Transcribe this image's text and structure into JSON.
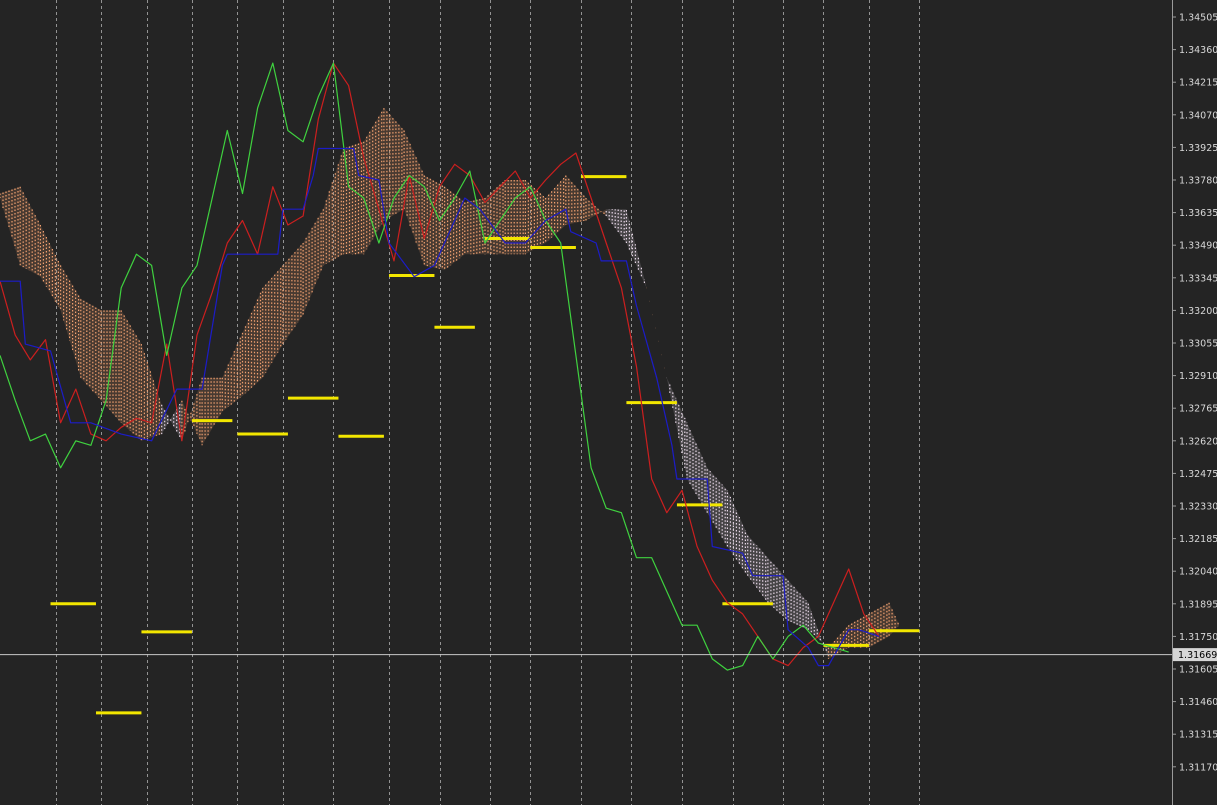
{
  "chart_data": {
    "type": "line",
    "title": "",
    "xlabel": "",
    "ylabel": "",
    "ylim": [
      1.311,
      1.3456
    ],
    "y_ticks": [
      "1.34505",
      "1.34360",
      "1.34215",
      "1.34070",
      "1.33925",
      "1.33780",
      "1.33635",
      "1.33490",
      "1.33345",
      "1.33200",
      "1.33055",
      "1.32910",
      "1.32765",
      "1.32620",
      "1.32475",
      "1.32330",
      "1.32185",
      "1.32040",
      "1.31895",
      "1.31750",
      "1.31605",
      "1.31460",
      "1.31315",
      "1.31170"
    ],
    "current_price": {
      "value": 1.31669,
      "label": "1.31669"
    },
    "grid": "vertical-dashed",
    "n_x": 232,
    "vertical_grid_x": [
      11,
      20,
      29,
      38,
      47,
      56,
      66,
      77,
      87,
      97,
      105,
      115,
      125,
      135,
      145,
      155,
      163,
      172,
      182
    ],
    "levels": [
      {
        "x0": 10,
        "x1": 19,
        "y": 1.31895
      },
      {
        "x0": 19,
        "x1": 28,
        "y": 1.3141
      },
      {
        "x0": 28,
        "x1": 38,
        "y": 1.3177
      },
      {
        "x0": 38,
        "x1": 46,
        "y": 1.3271
      },
      {
        "x0": 47,
        "x1": 57,
        "y": 1.3265
      },
      {
        "x0": 57,
        "x1": 67,
        "y": 1.3281
      },
      {
        "x0": 67,
        "x1": 76,
        "y": 1.3264
      },
      {
        "x0": 77,
        "x1": 86,
        "y": 1.33355
      },
      {
        "x0": 86,
        "x1": 94,
        "y": 1.33125
      },
      {
        "x0": 96,
        "x1": 105,
        "y": 1.3352
      },
      {
        "x0": 105,
        "x1": 114,
        "y": 1.3348
      },
      {
        "x0": 115,
        "x1": 124,
        "y": 1.33795
      },
      {
        "x0": 124,
        "x1": 134,
        "y": 1.3279
      },
      {
        "x0": 134,
        "x1": 143,
        "y": 1.32335
      },
      {
        "x0": 143,
        "x1": 153,
        "y": 1.31895
      },
      {
        "x0": 163,
        "x1": 172,
        "y": 1.3171
      },
      {
        "x0": 172,
        "x1": 182,
        "y": 1.31775
      }
    ],
    "series": [
      {
        "kind": "price",
        "color": "#cc1f1f",
        "x": [
          0,
          3,
          6,
          9,
          12,
          15,
          18,
          21,
          24,
          27,
          30,
          33,
          36,
          39,
          42,
          45,
          48,
          51,
          54,
          57,
          60,
          63,
          66,
          69,
          72,
          75,
          78,
          81,
          84,
          87,
          90,
          93,
          96,
          99,
          102,
          105,
          108,
          111,
          114,
          117,
          120,
          123,
          126,
          129,
          132,
          135,
          138,
          141,
          144,
          147,
          150,
          153,
          156,
          159,
          162,
          165,
          168,
          171,
          174
        ],
        "values": [
          1.3333,
          1.3309,
          1.3298,
          1.3307,
          1.327,
          1.3285,
          1.3265,
          1.3262,
          1.3268,
          1.3272,
          1.327,
          1.3305,
          1.3262,
          1.3309,
          1.3328,
          1.335,
          1.336,
          1.3345,
          1.3375,
          1.3358,
          1.3362,
          1.3405,
          1.343,
          1.342,
          1.3388,
          1.3365,
          1.3342,
          1.338,
          1.3352,
          1.3375,
          1.3385,
          1.338,
          1.3368,
          1.3375,
          1.3382,
          1.337,
          1.3378,
          1.3385,
          1.339,
          1.337,
          1.335,
          1.333,
          1.3295,
          1.3245,
          1.323,
          1.324,
          1.3215,
          1.32,
          1.319,
          1.3185,
          1.3175,
          1.3165,
          1.3162,
          1.317,
          1.3175,
          1.319,
          1.3205,
          1.3185,
          1.3175
        ]
      },
      {
        "kind": "lagging",
        "color": "#3fd23f",
        "x": [
          0,
          3,
          6,
          9,
          12,
          15,
          18,
          21,
          24,
          27,
          30,
          33,
          36,
          39,
          42,
          45,
          48,
          51,
          54,
          57,
          60,
          63,
          66,
          69,
          72,
          75,
          78,
          81,
          84,
          87,
          90,
          93,
          96,
          99,
          102,
          105,
          108,
          111,
          114,
          117,
          120,
          123,
          126,
          129,
          132,
          135,
          138,
          141,
          144,
          147,
          150,
          153,
          156,
          159,
          162,
          165,
          168
        ],
        "values": [
          1.33,
          1.328,
          1.3262,
          1.3265,
          1.325,
          1.3262,
          1.326,
          1.328,
          1.333,
          1.3345,
          1.334,
          1.33,
          1.333,
          1.334,
          1.337,
          1.34,
          1.3372,
          1.341,
          1.343,
          1.34,
          1.3395,
          1.3415,
          1.343,
          1.3375,
          1.337,
          1.335,
          1.337,
          1.338,
          1.3375,
          1.336,
          1.337,
          1.3382,
          1.335,
          1.336,
          1.337,
          1.3375,
          1.336,
          1.335,
          1.33,
          1.325,
          1.3232,
          1.323,
          1.321,
          1.321,
          1.3195,
          1.318,
          1.318,
          1.3165,
          1.316,
          1.3162,
          1.3175,
          1.3165,
          1.3175,
          1.318,
          1.3172,
          1.317,
          1.3168
        ]
      },
      {
        "kind": "kijun",
        "color": "#1c1cc8",
        "x": [
          0,
          4,
          5,
          10,
          14,
          18,
          24,
          30,
          35,
          40,
          44,
          45,
          55,
          56,
          60,
          62,
          63,
          70,
          71,
          75,
          77,
          82,
          86,
          90,
          92,
          95,
          100,
          104,
          108,
          112,
          113,
          118,
          119,
          124,
          126,
          130,
          133,
          134,
          140,
          141,
          147,
          149,
          155,
          156,
          160,
          162,
          164,
          168,
          170,
          174
        ],
        "values": [
          1.3333,
          1.3333,
          1.3305,
          1.3302,
          1.327,
          1.327,
          1.3265,
          1.3262,
          1.3285,
          1.3285,
          1.334,
          1.3345,
          1.3345,
          1.3365,
          1.3365,
          1.338,
          1.3392,
          1.3392,
          1.338,
          1.3378,
          1.335,
          1.3335,
          1.334,
          1.336,
          1.337,
          1.3365,
          1.335,
          1.335,
          1.336,
          1.3365,
          1.3355,
          1.335,
          1.3342,
          1.3342,
          1.3322,
          1.329,
          1.326,
          1.3245,
          1.3245,
          1.3215,
          1.3212,
          1.3202,
          1.3202,
          1.3178,
          1.317,
          1.3162,
          1.3162,
          1.3178,
          1.3178,
          1.3175
        ]
      }
    ],
    "cloud": {
      "x": [
        0,
        4,
        8,
        12,
        16,
        20,
        24,
        28,
        32,
        36,
        40,
        44,
        48,
        52,
        56,
        60,
        64,
        68,
        72,
        76,
        80,
        84,
        88,
        92,
        96,
        100,
        104,
        108,
        112,
        116,
        120,
        124,
        128,
        132,
        136,
        140,
        144,
        148,
        152,
        156,
        160,
        164,
        168,
        172,
        176,
        178
      ],
      "span_a": [
        1.3372,
        1.3375,
        1.3358,
        1.334,
        1.3325,
        1.332,
        1.332,
        1.3305,
        1.3278,
        1.3262,
        1.329,
        1.329,
        1.331,
        1.333,
        1.334,
        1.335,
        1.3365,
        1.3392,
        1.3395,
        1.341,
        1.34,
        1.338,
        1.3375,
        1.3368,
        1.337,
        1.3378,
        1.3378,
        1.337,
        1.338,
        1.337,
        1.3362,
        1.335,
        1.333,
        1.329,
        1.3245,
        1.323,
        1.3215,
        1.3202,
        1.319,
        1.3182,
        1.3178,
        1.317,
        1.318,
        1.3185,
        1.319,
        1.318
      ],
      "span_b": [
        1.337,
        1.334,
        1.3335,
        1.332,
        1.329,
        1.328,
        1.327,
        1.3262,
        1.3265,
        1.328,
        1.326,
        1.3275,
        1.3282,
        1.329,
        1.3305,
        1.3318,
        1.334,
        1.3345,
        1.3345,
        1.336,
        1.3365,
        1.334,
        1.3338,
        1.3345,
        1.3345,
        1.3345,
        1.3345,
        1.335,
        1.3358,
        1.336,
        1.3365,
        1.3365,
        1.333,
        1.329,
        1.327,
        1.325,
        1.324,
        1.322,
        1.321,
        1.32,
        1.319,
        1.3165,
        1.317,
        1.317,
        1.3175,
        1.318
      ],
      "bull_color": "#f0a070",
      "bear_color": "#e6d6e6"
    }
  }
}
